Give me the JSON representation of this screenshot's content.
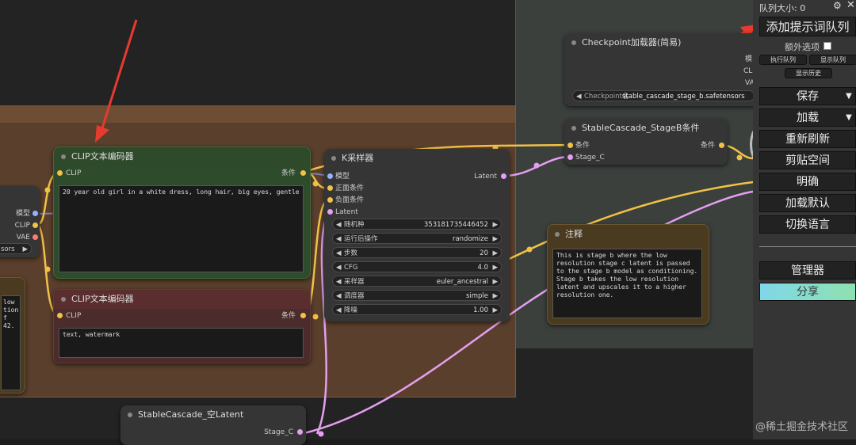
{
  "nodes": {
    "clip_positive": {
      "title": "CLIP文本编码器",
      "in_clip": "CLIP",
      "out_cond": "条件",
      "text": "20 year old girl in a white dress, long hair, big eyes, gentle"
    },
    "clip_negative": {
      "title": "CLIP文本编码器",
      "in_clip": "CLIP",
      "out_cond": "条件",
      "text": "text, watermark"
    },
    "ksampler": {
      "title": "K采样器",
      "inputs": [
        "模型",
        "正面条件",
        "负面条件",
        "Latent"
      ],
      "output": "Latent",
      "widgets": [
        {
          "label": "随机种",
          "value": "353181735446452"
        },
        {
          "label": "运行后操作",
          "value": "randomize"
        },
        {
          "label": "步数",
          "value": "20"
        },
        {
          "label": "CFG",
          "value": "4.0"
        },
        {
          "label": "采样器",
          "value": "euler_ancestral"
        },
        {
          "label": "调度器",
          "value": "simple"
        },
        {
          "label": "降噪",
          "value": "1.00"
        }
      ]
    },
    "checkpoint": {
      "title": "Checkpoint加载器(简易)",
      "outputs": [
        "模",
        "CL",
        "VA"
      ],
      "widget_label": "Checkpoint名",
      "widget_value": "stable_cascade_stage_b.safetensors"
    },
    "stageb": {
      "title": "StableCascade_StageB条件",
      "in_cond": "条件",
      "in_stagec": "Stage_C",
      "out_cond": "条件"
    },
    "note": {
      "title": "注释",
      "text": "This is stage b where the low resolution stage c latent is passed to the stage b model as conditioning. Stage b takes the low resolution latent and upscales it to a higher resolution one."
    },
    "empty_latent": {
      "title": "StableCascade_空Latent",
      "out_stagec": "Stage_C"
    },
    "left_partial": {
      "outputs": [
        "模型",
        "CLIP",
        "VAE"
      ],
      "widget_value": "sors"
    },
    "left_note_partial": {
      "lines": [
        "low",
        "tion",
        "f",
        "42."
      ]
    }
  },
  "panel": {
    "queue_size": "队列大小: 0",
    "add_prompt": "添加提示词队列",
    "extra_options": "额外选项",
    "run_queue": "执行队列",
    "show_queue": "显示队列",
    "show_history": "显示历史",
    "save": "保存",
    "load": "加载",
    "refresh": "重新刷新",
    "clipspace": "剪贴空间",
    "clear": "明确",
    "load_default": "加载默认",
    "switch_lang": "切换语言",
    "manager": "管理器",
    "share": "分享"
  },
  "watermark": "@稀土掘金技术社区",
  "colors": {
    "clip_title": "#2f4a2a",
    "clip_body": "#2e4b2b",
    "neg_title": "#5a2e2e",
    "neg_body": "#4b2b2b",
    "note": "#4a3b20",
    "share": "#7ed8e8",
    "arrow": "#e63b2e"
  }
}
